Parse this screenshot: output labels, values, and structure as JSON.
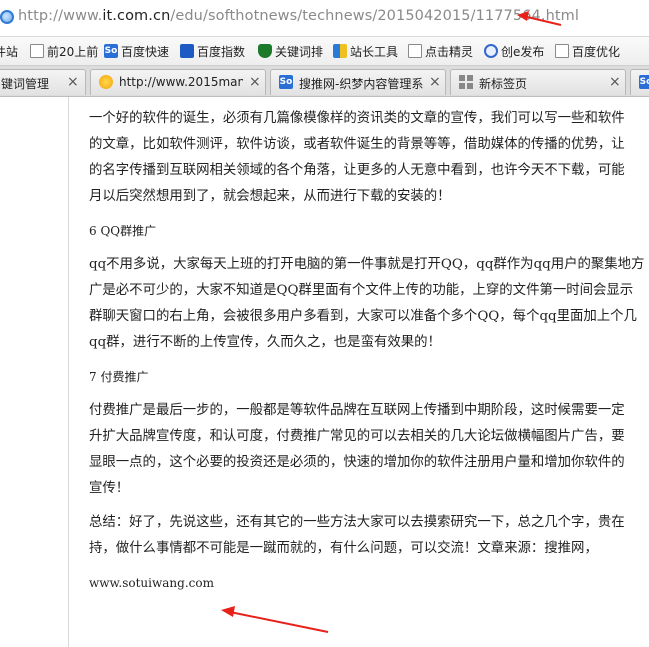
{
  "address_bar": {
    "url_prefix": "http://www.",
    "url_host": "it.com.cn",
    "url_path": "/edu/softhotnews/technews/2015042015/1177564.html"
  },
  "bookmarks": [
    {
      "label": "件站",
      "icon": "page-icon"
    },
    {
      "label": "前20上前",
      "icon": "page-icon"
    },
    {
      "label": "百度快速",
      "icon": "so-icon"
    },
    {
      "label": "百度指数",
      "icon": "baidu-paw-icon"
    },
    {
      "label": "关键词排",
      "icon": "shield-icon"
    },
    {
      "label": "站长工具",
      "icon": "flag-icon"
    },
    {
      "label": "点击精灵",
      "icon": "page-icon"
    },
    {
      "label": "创e发布",
      "icon": "e-icon"
    },
    {
      "label": "百度优化",
      "icon": "page-icon"
    }
  ],
  "tabs": [
    {
      "label": "键词管理",
      "icon": "",
      "close": "×"
    },
    {
      "label": "http://www.2015man.c",
      "icon": "sun-icon",
      "close": "×"
    },
    {
      "label": "搜推网-织梦内容管理系",
      "icon": "so-icon",
      "close": "×"
    },
    {
      "label": "新标签页",
      "icon": "grid-icon",
      "close": "×"
    },
    {
      "label": "",
      "icon": "so-icon",
      "close": ""
    }
  ],
  "article": {
    "p1": [
      "一个好的软件的诞生，必须有几篇像模像样的资讯类的文章的宣传，我们可以写一些和软件",
      "的文章，比如软件测评，软件访谈，或者软件诞生的背景等等，借助媒体的传播的优势，让",
      "的名字传播到互联网相关领域的各个角落，让更多的人无意中看到，也许今天不下载，可能",
      "月以后突然想用到了，就会想起来，从而进行下载的安装的！"
    ],
    "h6": "6 QQ群推广",
    "p2": [
      "qq不用多说，大家每天上班的打开电脑的第一件事就是打开QQ，qq群作为qq用户的聚集地方",
      "广是必不可少的，大家不知道是QQ群里面有个文件上传的功能，上穿的文件第一时间会显示",
      "群聊天窗口的右上角，会被很多用户多看到，大家可以准备个多个QQ，每个qq里面加上个几",
      "qq群，进行不断的上传宣传，久而久之，也是蛮有效果的！"
    ],
    "h7": "7 付费推广",
    "p3": [
      "付费推广是最后一步的，一般都是等软件品牌在互联网上传播到中期阶段，这时候需要一定",
      "升扩大品牌宣传度，和认可度，付费推广常见的可以去相关的几大论坛做横幅图片广告，要",
      "显眼一点的，这个必要的投资还是必须的，快速的增加你的软件注册用户量和增加你软件的",
      "宣传！"
    ],
    "p4": [
      "总结：好了，先说这些，还有其它的一些方法大家可以去摸索研究一下，总之几个字，贵在",
      "持，做什么事情都不可能是一蹴而就的，有什么问题，可以交流！文章来源：搜推网，"
    ],
    "source_url": "www.sotuiwang.com"
  },
  "colors": {
    "arrow": "#e8211a",
    "link_accent": "#2f7bd6"
  }
}
